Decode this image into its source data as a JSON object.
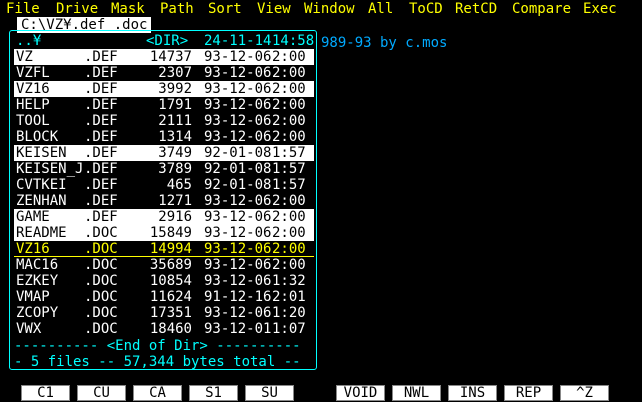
{
  "menu": [
    "File",
    "Drive",
    "Mask",
    "Path",
    "Sort",
    "View",
    "Window",
    "All",
    "ToCD",
    "RetCD",
    "Compare",
    "Exec"
  ],
  "path": "C:\\VZ¥.def .doc",
  "background_text": "989-93 by c.mos",
  "parent_dir": {
    "name": "..¥",
    "tag": "<DIR>",
    "date": "24-11-14",
    "time": "14:58"
  },
  "files": [
    {
      "name": "VZ",
      "ext": ".DEF",
      "size": "14737",
      "date": "93-12-06",
      "time": "2:00",
      "state": "highlight"
    },
    {
      "name": "VZFL",
      "ext": ".DEF",
      "size": "2307",
      "date": "93-12-06",
      "time": "2:00",
      "state": ""
    },
    {
      "name": "VZ16",
      "ext": ".DEF",
      "size": "3992",
      "date": "93-12-06",
      "time": "2:00",
      "state": "highlight"
    },
    {
      "name": "HELP",
      "ext": ".DEF",
      "size": "1791",
      "date": "93-12-06",
      "time": "2:00",
      "state": ""
    },
    {
      "name": "TOOL",
      "ext": ".DEF",
      "size": "2111",
      "date": "93-12-06",
      "time": "2:00",
      "state": ""
    },
    {
      "name": "BLOCK",
      "ext": ".DEF",
      "size": "1314",
      "date": "93-12-06",
      "time": "2:00",
      "state": ""
    },
    {
      "name": "KEISEN",
      "ext": ".DEF",
      "size": "3749",
      "date": "92-01-08",
      "time": "1:57",
      "state": "highlight"
    },
    {
      "name": "KEISEN_J",
      "ext": ".DEF",
      "size": "3789",
      "date": "92-01-08",
      "time": "1:57",
      "state": ""
    },
    {
      "name": "CVTKEI",
      "ext": ".DEF",
      "size": "465",
      "date": "92-01-08",
      "time": "1:57",
      "state": ""
    },
    {
      "name": "ZENHAN",
      "ext": ".DEF",
      "size": "1271",
      "date": "93-12-06",
      "time": "2:00",
      "state": ""
    },
    {
      "name": "GAME",
      "ext": ".DEF",
      "size": "2916",
      "date": "93-12-06",
      "time": "2:00",
      "state": "highlight"
    },
    {
      "name": "README",
      "ext": ".DOC",
      "size": "15849",
      "date": "93-12-06",
      "time": "2:00",
      "state": "highlight"
    },
    {
      "name": "VZ16",
      "ext": ".DOC",
      "size": "14994",
      "date": "93-12-06",
      "time": "2:00",
      "state": "cursor"
    },
    {
      "name": "MAC16",
      "ext": ".DOC",
      "size": "35689",
      "date": "93-12-06",
      "time": "2:00",
      "state": ""
    },
    {
      "name": "EZKEY",
      "ext": ".DOC",
      "size": "10854",
      "date": "93-12-06",
      "time": "1:32",
      "state": ""
    },
    {
      "name": "VMAP",
      "ext": ".DOC",
      "size": "11624",
      "date": "91-12-16",
      "time": "2:01",
      "state": ""
    },
    {
      "name": "ZCOPY",
      "ext": ".DOC",
      "size": "17351",
      "date": "93-12-06",
      "time": "1:20",
      "state": ""
    },
    {
      "name": "VWX",
      "ext": ".DOC",
      "size": "18460",
      "date": "93-12-01",
      "time": "1:07",
      "state": ""
    }
  ],
  "end_of_dir": "---------- <End of Dir> ----------",
  "summary": "- 5 files -- 57,344 bytes total --",
  "fkeys": [
    "C1",
    "CU",
    "CA",
    "S1",
    "SU",
    "",
    "VOID",
    "NWL",
    "INS",
    "REP",
    "^Z"
  ]
}
